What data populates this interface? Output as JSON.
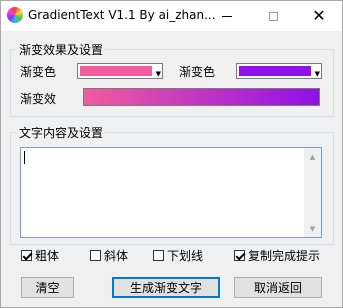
{
  "window": {
    "title": "GradientText V1.1 By ai_zhan..."
  },
  "effects_group": {
    "legend": "渐变效果及设置",
    "start_color_label": "渐变色",
    "end_color_label": "渐变色",
    "preview_label": "渐变效",
    "start_color": "#f05c9c",
    "end_color": "#9010e8"
  },
  "text_group": {
    "legend": "文字内容及设置",
    "content": ""
  },
  "options": [
    {
      "label": "粗体",
      "checked": true
    },
    {
      "label": "斜体",
      "checked": false
    },
    {
      "label": "下划线",
      "checked": false
    },
    {
      "label": "复制完成提示",
      "checked": true
    }
  ],
  "buttons": {
    "clear": "清空",
    "generate": "生成渐变文字",
    "cancel": "取消返回"
  }
}
